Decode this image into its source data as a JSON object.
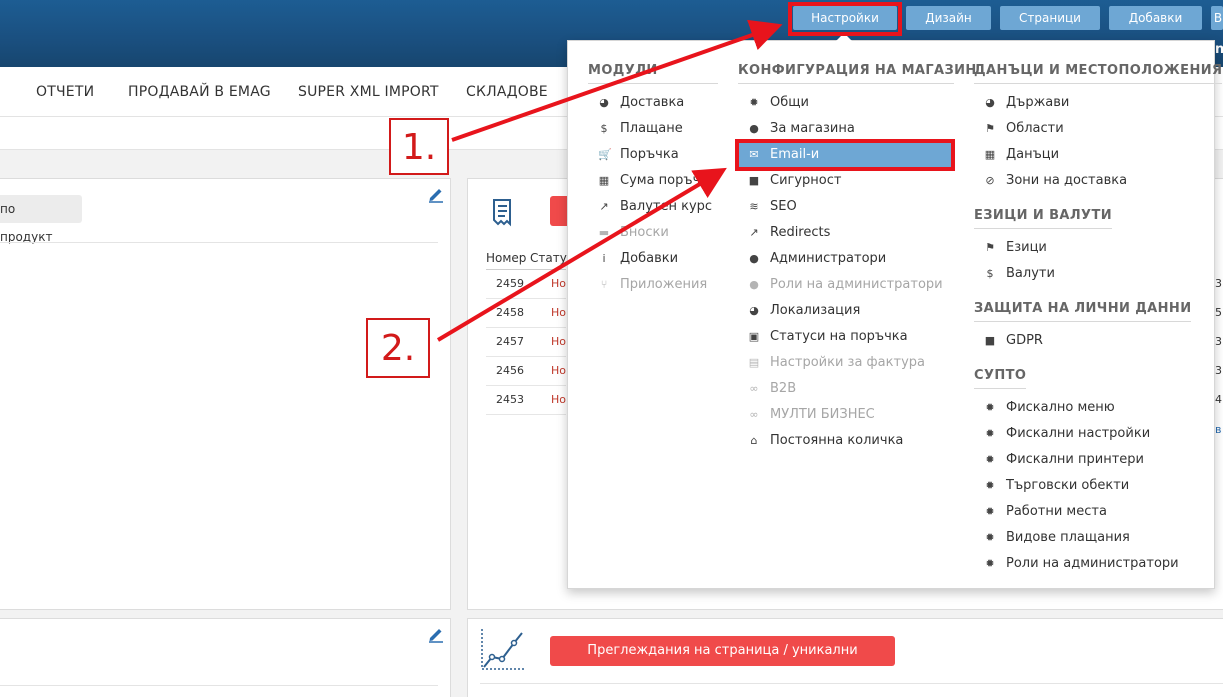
{
  "topbar": {
    "buttons": [
      "Настройки",
      "Дизайн",
      "Страници",
      "Добавки",
      "В"
    ],
    "edge_char": "n"
  },
  "navbar": {
    "items": [
      "ОТЧЕТИ",
      "ПРОДАВАЙ В EMAG",
      "SUPER XML IMPORT",
      "СКЛАДОВЕ"
    ]
  },
  "left_panel": {
    "button_label": "по продукт"
  },
  "orders_panel": {
    "headers": [
      "Номер",
      "Статус"
    ],
    "rows": [
      {
        "number": "2459",
        "status": "Но"
      },
      {
        "number": "2458",
        "status": "Но"
      },
      {
        "number": "2457",
        "status": "Но"
      },
      {
        "number": "2456",
        "status": "Но"
      },
      {
        "number": "2453",
        "status": "Но"
      }
    ],
    "edge_values": [
      "3.",
      "5.",
      "3.",
      "3.",
      "4."
    ],
    "edge_link": "в"
  },
  "visits_panel": {
    "button_label": "Преглеждания на страница / уникални посетители"
  },
  "dropdown": {
    "col1": {
      "heading": "МОДУЛИ",
      "items": [
        {
          "label": "Доставка",
          "icon": "globe-icon",
          "glyph": "◕",
          "disabled": false
        },
        {
          "label": "Плащане",
          "icon": "dollar-icon",
          "glyph": "$",
          "disabled": false
        },
        {
          "label": "Поръчка",
          "icon": "cart-icon",
          "glyph": "🛒",
          "disabled": false
        },
        {
          "label": "Сума поръчка",
          "icon": "calculator-icon",
          "glyph": "▦",
          "disabled": false
        },
        {
          "label": "Валутен курс",
          "icon": "chart-icon",
          "glyph": "↗",
          "disabled": false
        },
        {
          "label": "Бноски",
          "icon": "card-icon",
          "glyph": "▬",
          "disabled": true
        },
        {
          "label": "Добавки",
          "icon": "info-icon",
          "glyph": "i",
          "disabled": false
        },
        {
          "label": "Приложения",
          "icon": "branch-icon",
          "glyph": "⑂",
          "disabled": true
        }
      ]
    },
    "col2": {
      "heading": "КОНФИГУРАЦИЯ НА МАГАЗИН",
      "items": [
        {
          "label": "Общи",
          "icon": "gear-icon",
          "glyph": "✹",
          "disabled": false
        },
        {
          "label": "За магазина",
          "icon": "user-icon",
          "glyph": "●",
          "disabled": false
        },
        {
          "label": "Email-и",
          "icon": "envelope-icon",
          "glyph": "✉",
          "disabled": false,
          "active": true
        },
        {
          "label": "Сигурност",
          "icon": "lock-icon",
          "glyph": "■",
          "disabled": false
        },
        {
          "label": "SEO",
          "icon": "seo-icon",
          "glyph": "≋",
          "disabled": false
        },
        {
          "label": "Redirects",
          "icon": "external-link-icon",
          "glyph": "↗",
          "disabled": false
        },
        {
          "label": "Администратори",
          "icon": "users-icon",
          "glyph": "●",
          "disabled": false
        },
        {
          "label": "Роли на администратори",
          "icon": "users-icon",
          "glyph": "●",
          "disabled": true
        },
        {
          "label": "Локализация",
          "icon": "globe-icon",
          "glyph": "◕",
          "disabled": false
        },
        {
          "label": "Статуси на поръчка",
          "icon": "clipboard-icon",
          "glyph": "▣",
          "disabled": false
        },
        {
          "label": "Настройки за фактура",
          "icon": "file-icon",
          "glyph": "▤",
          "disabled": true
        },
        {
          "label": "B2B",
          "icon": "link-icon",
          "glyph": "∞",
          "disabled": true
        },
        {
          "label": "МУЛТИ БИЗНЕС",
          "icon": "link-icon",
          "glyph": "∞",
          "disabled": true
        },
        {
          "label": "Постоянна количка",
          "icon": "home-icon",
          "glyph": "⌂",
          "disabled": false
        }
      ]
    },
    "col3": {
      "sections": [
        {
          "heading": "ДАНЪЦИ И МЕСТОПОЛОЖЕНИЯ",
          "items": [
            {
              "label": "Държави",
              "icon": "globe-icon",
              "glyph": "◕"
            },
            {
              "label": "Области",
              "icon": "flag-icon",
              "glyph": "⚑"
            },
            {
              "label": "Данъци",
              "icon": "calculator-icon",
              "glyph": "▦"
            },
            {
              "label": "Зони на доставка",
              "icon": "compass-icon",
              "glyph": "⊘"
            }
          ]
        },
        {
          "heading": "ЕЗИЦИ И ВАЛУТИ",
          "items": [
            {
              "label": "Езици",
              "icon": "flag-icon",
              "glyph": "⚑"
            },
            {
              "label": "Валути",
              "icon": "dollar-icon",
              "glyph": "$"
            }
          ]
        },
        {
          "heading": "ЗАЩИТА НА ЛИЧНИ ДАННИ",
          "items": [
            {
              "label": "GDPR",
              "icon": "lock-icon",
              "glyph": "■"
            }
          ]
        },
        {
          "heading": "СУПТО",
          "items": [
            {
              "label": "Фискално меню",
              "icon": "gear-icon",
              "glyph": "✹"
            },
            {
              "label": "Фискални настройки",
              "icon": "gear-icon",
              "glyph": "✹"
            },
            {
              "label": "Фискални принтери",
              "icon": "gear-icon",
              "glyph": "✹"
            },
            {
              "label": "Търговски обекти",
              "icon": "gear-icon",
              "glyph": "✹"
            },
            {
              "label": "Работни места",
              "icon": "gear-icon",
              "glyph": "✹"
            },
            {
              "label": "Видове плащания",
              "icon": "gear-icon",
              "glyph": "✹"
            },
            {
              "label": "Роли на администратори",
              "icon": "gear-icon",
              "glyph": "✹"
            }
          ]
        }
      ]
    }
  },
  "annotations": {
    "step1": "1.",
    "step2": "2."
  },
  "colors": {
    "highlight": "#e8141c",
    "active_item": "#6ea7d4",
    "topbar": "#1a4f7f",
    "accent_red": "#f04a4a"
  }
}
